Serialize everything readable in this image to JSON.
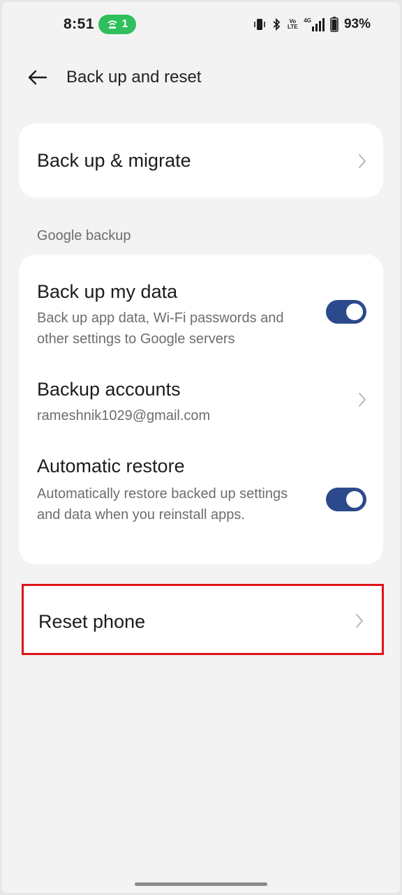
{
  "status_bar": {
    "time": "8:51",
    "hotspot_count": "1",
    "network_label": "4G",
    "volte_label_top": "Vo",
    "volte_label_bottom": "LTE",
    "battery": "93%",
    "colors": {
      "hotspot": "#2fbf5c"
    }
  },
  "header": {
    "back_icon": "arrow-left-icon",
    "title": "Back up and reset"
  },
  "migrate_card": {
    "title": "Back up & migrate"
  },
  "google_backup": {
    "section_label": "Google backup",
    "back_up_my_data": {
      "title": "Back up my data",
      "subtitle": "Back up app data, Wi-Fi passwords and other settings to Google servers",
      "enabled": true
    },
    "backup_accounts": {
      "title": "Backup accounts",
      "subtitle": "rameshnik1029@gmail.com"
    },
    "automatic_restore": {
      "title": "Automatic restore",
      "subtitle": "Automatically restore backed up settings and data when you reinstall apps.",
      "enabled": true
    }
  },
  "reset_card": {
    "title": "Reset phone"
  },
  "theme": {
    "toggle_on": "#2b4a8c",
    "highlight": "#e0121b",
    "background": "#f3f3f3"
  }
}
